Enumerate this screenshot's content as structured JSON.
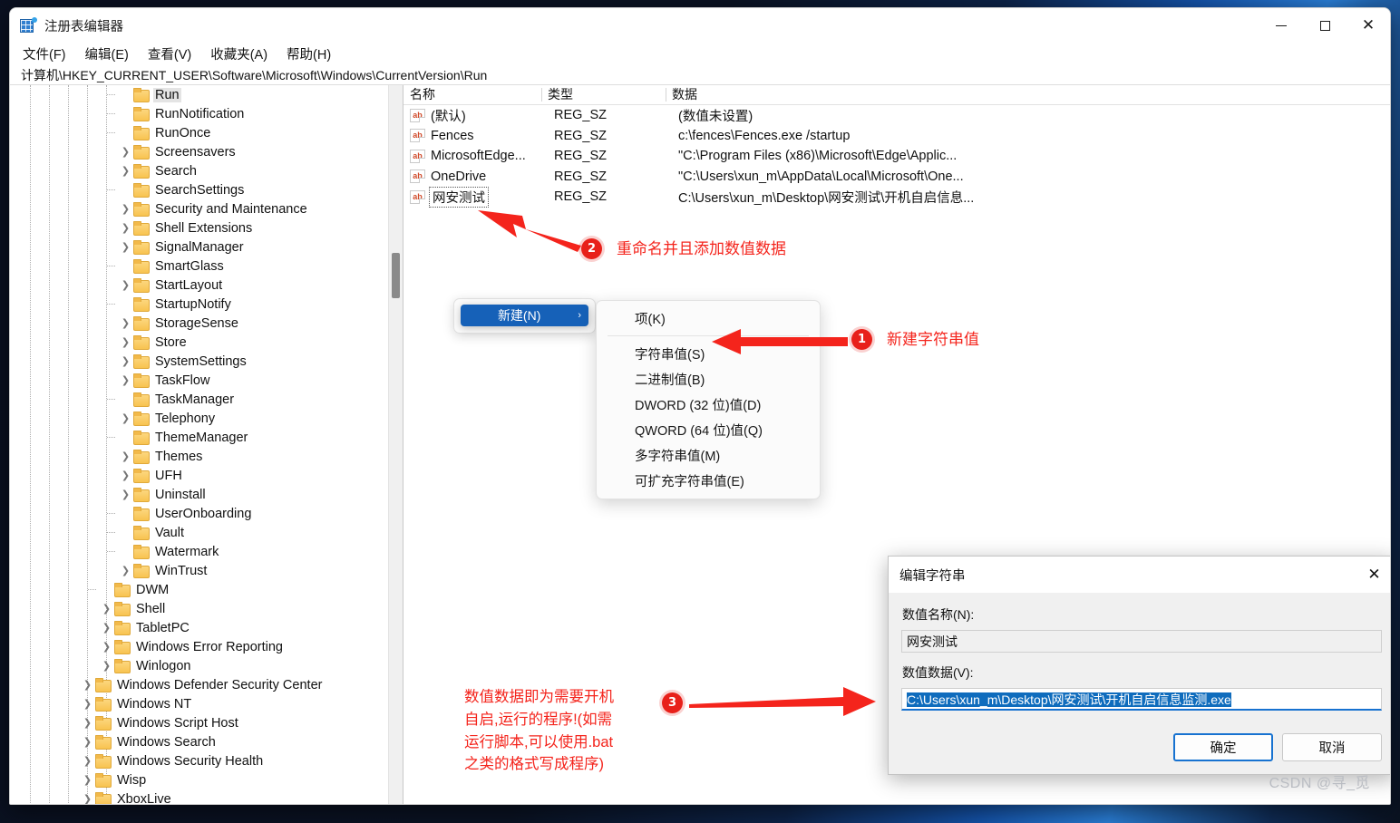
{
  "window": {
    "title": "注册表编辑器",
    "icon": "registry-editor-icon",
    "minimize": "—",
    "maximize": "□",
    "close": "✕"
  },
  "menubar": [
    "文件(F)",
    "编辑(E)",
    "查看(V)",
    "收藏夹(A)",
    "帮助(H)"
  ],
  "address": "计算机\\HKEY_CURRENT_USER\\Software\\Microsoft\\Windows\\CurrentVersion\\Run",
  "tree": {
    "items": [
      {
        "label": "Run",
        "indent": 5,
        "expand": "none",
        "selected": true
      },
      {
        "label": "RunNotification",
        "indent": 5,
        "expand": "none"
      },
      {
        "label": "RunOnce",
        "indent": 5,
        "expand": "none"
      },
      {
        "label": "Screensavers",
        "indent": 5,
        "expand": "collapsed"
      },
      {
        "label": "Search",
        "indent": 5,
        "expand": "collapsed"
      },
      {
        "label": "SearchSettings",
        "indent": 5,
        "expand": "none"
      },
      {
        "label": "Security and Maintenance",
        "indent": 5,
        "expand": "collapsed"
      },
      {
        "label": "Shell Extensions",
        "indent": 5,
        "expand": "collapsed"
      },
      {
        "label": "SignalManager",
        "indent": 5,
        "expand": "collapsed"
      },
      {
        "label": "SmartGlass",
        "indent": 5,
        "expand": "none"
      },
      {
        "label": "StartLayout",
        "indent": 5,
        "expand": "collapsed"
      },
      {
        "label": "StartupNotify",
        "indent": 5,
        "expand": "none"
      },
      {
        "label": "StorageSense",
        "indent": 5,
        "expand": "collapsed"
      },
      {
        "label": "Store",
        "indent": 5,
        "expand": "collapsed"
      },
      {
        "label": "SystemSettings",
        "indent": 5,
        "expand": "collapsed"
      },
      {
        "label": "TaskFlow",
        "indent": 5,
        "expand": "collapsed"
      },
      {
        "label": "TaskManager",
        "indent": 5,
        "expand": "none"
      },
      {
        "label": "Telephony",
        "indent": 5,
        "expand": "collapsed"
      },
      {
        "label": "ThemeManager",
        "indent": 5,
        "expand": "none"
      },
      {
        "label": "Themes",
        "indent": 5,
        "expand": "collapsed"
      },
      {
        "label": "UFH",
        "indent": 5,
        "expand": "collapsed"
      },
      {
        "label": "Uninstall",
        "indent": 5,
        "expand": "collapsed"
      },
      {
        "label": "UserOnboarding",
        "indent": 5,
        "expand": "none"
      },
      {
        "label": "Vault",
        "indent": 5,
        "expand": "none"
      },
      {
        "label": "Watermark",
        "indent": 5,
        "expand": "none"
      },
      {
        "label": "WinTrust",
        "indent": 5,
        "expand": "collapsed"
      },
      {
        "label": "DWM",
        "indent": 4,
        "expand": "none"
      },
      {
        "label": "Shell",
        "indent": 4,
        "expand": "collapsed"
      },
      {
        "label": "TabletPC",
        "indent": 4,
        "expand": "collapsed"
      },
      {
        "label": "Windows Error Reporting",
        "indent": 4,
        "expand": "collapsed"
      },
      {
        "label": "Winlogon",
        "indent": 4,
        "expand": "collapsed"
      },
      {
        "label": "Windows Defender Security Center",
        "indent": 3,
        "expand": "collapsed"
      },
      {
        "label": "Windows NT",
        "indent": 3,
        "expand": "collapsed"
      },
      {
        "label": "Windows Script Host",
        "indent": 3,
        "expand": "collapsed"
      },
      {
        "label": "Windows Search",
        "indent": 3,
        "expand": "collapsed"
      },
      {
        "label": "Windows Security Health",
        "indent": 3,
        "expand": "collapsed"
      },
      {
        "label": "Wisp",
        "indent": 3,
        "expand": "collapsed"
      },
      {
        "label": "XboxLive",
        "indent": 3,
        "expand": "collapsed"
      }
    ]
  },
  "list": {
    "columns": [
      "名称",
      "类型",
      "数据"
    ],
    "rows": [
      {
        "name": "(默认)",
        "type": "REG_SZ",
        "data": "(数值未设置)",
        "focused": false
      },
      {
        "name": "Fences",
        "type": "REG_SZ",
        "data": "c:\\fences\\Fences.exe /startup",
        "focused": false
      },
      {
        "name": "MicrosoftEdge...",
        "type": "REG_SZ",
        "data": "\"C:\\Program Files (x86)\\Microsoft\\Edge\\Applic...",
        "focused": false
      },
      {
        "name": "OneDrive",
        "type": "REG_SZ",
        "data": "\"C:\\Users\\xun_m\\AppData\\Local\\Microsoft\\One...",
        "focused": false
      },
      {
        "name": "网安测试",
        "type": "REG_SZ",
        "data": "C:\\Users\\xun_m\\Desktop\\网安测试\\开机自启信息...",
        "focused": true
      }
    ]
  },
  "context_menu": {
    "parent_label": "新建(N)",
    "parent_arrow": "›",
    "items": [
      "项(K)",
      "字符串值(S)",
      "二进制值(B)",
      "DWORD (32 位)值(D)",
      "QWORD (64 位)值(Q)",
      "多字符串值(M)",
      "可扩充字符串值(E)"
    ]
  },
  "dialog": {
    "title": "编辑字符串",
    "close": "✕",
    "name_label": "数值名称(N):",
    "name_value": "网安测试",
    "data_label": "数值数据(V):",
    "data_value": "C:\\Users\\xun_m\\Desktop\\网安测试\\开机自启信息监测.exe",
    "ok": "确定",
    "cancel": "取消"
  },
  "annotations": [
    {
      "badge": "1",
      "text": "新建字符串值"
    },
    {
      "badge": "2",
      "text": "重命名并且添加数值数据"
    },
    {
      "badge": "3",
      "text": "数值数据即为需要开机\n自启,运行的程序!(如需\n运行脚本,可以使用.bat\n之类的格式写成程序)"
    }
  ],
  "watermark": "CSDN @寻_觅",
  "colors": {
    "accent": "#1661b8",
    "annotation": "#f4241c",
    "badge": "#e8201a",
    "selection": "#0f6cbd",
    "folder": "#f8c350"
  }
}
